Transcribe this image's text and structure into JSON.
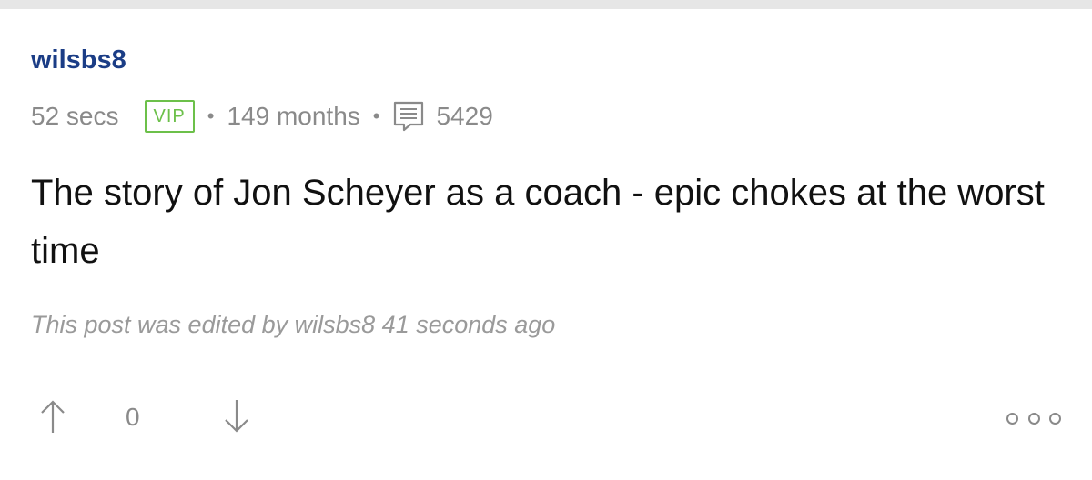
{
  "post": {
    "username": "wilsbs8",
    "time_ago": "52 secs",
    "badge": "VIP",
    "tenure": "149 months",
    "comment_count": "5429",
    "body": "The story of Jon Scheyer as a coach - epic chokes at the worst time",
    "edit_note": "This post was edited by wilsbs8 41 seconds ago",
    "score": "0"
  },
  "icons": {
    "upvote": "arrow-up-icon",
    "downvote": "arrow-down-icon",
    "comments": "comment-bubble-icon",
    "more": "more-options-icon"
  },
  "colors": {
    "username": "#1b3d86",
    "vip_badge": "#6cc04a",
    "meta_text": "#8a8a8a",
    "body_text": "#111111",
    "divider": "#e6e6e6"
  }
}
